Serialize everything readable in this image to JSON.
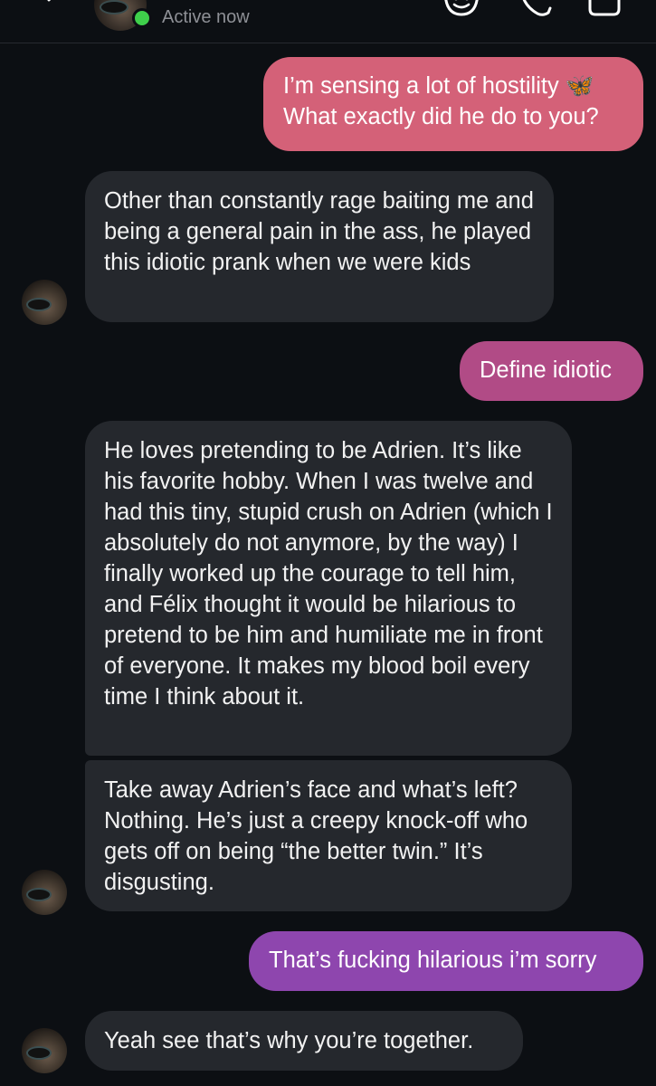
{
  "header": {
    "status_text": "Active now",
    "online_color": "#3fd04b",
    "icons": [
      "back-chevron-icon",
      "sticker-icon",
      "phone-icon",
      "video-camera-icon"
    ]
  },
  "messages": [
    {
      "direction": "out",
      "text": "I’m sensing a lot of hostility 🦋\nWhat exactly did he do to you?",
      "color": "#d46178"
    },
    {
      "direction": "in",
      "text": "Other than constantly rage baiting me and being a general pain in the ass, he played this idiotic prank when we were kids"
    },
    {
      "direction": "out",
      "text": "Define idiotic",
      "color": "#b14b86"
    },
    {
      "direction": "in",
      "text": "He loves pretending to be Adrien. It’s like his favorite hobby. When I was twelve and had this tiny, stupid crush on Adrien (which I absolutely do not anymore, by the way) I finally worked up the courage to tell him, and Félix thought it would be hilarious to pretend to be him and humiliate me in front of everyone. It makes my blood boil every time I think about it."
    },
    {
      "direction": "in",
      "text": "Take away Adrien’s face and what’s left? Nothing. He’s just a creepy knock-off who gets off on being “the better twin.” It’s disgusting."
    },
    {
      "direction": "out",
      "text": "That’s fucking hilarious i’m sorry",
      "color": "#8e46ae"
    },
    {
      "direction": "in",
      "text": "Yeah see that’s why you’re together."
    }
  ]
}
